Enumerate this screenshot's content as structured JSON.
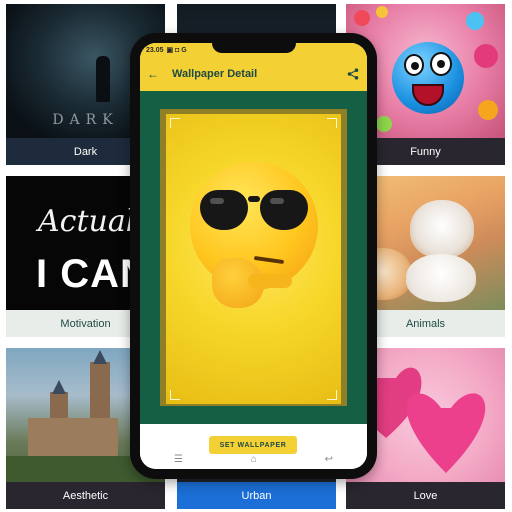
{
  "categories": [
    {
      "id": "dark",
      "label": "Dark",
      "art_text": "DARK"
    },
    {
      "id": "urban-top",
      "label": ""
    },
    {
      "id": "funny",
      "label": "Funny"
    },
    {
      "id": "motivation",
      "label": "Motivation",
      "art_line1": "Actually",
      "art_line2": "I CAN"
    },
    {
      "id": "animals",
      "label": "Animals"
    },
    {
      "id": "aesthetic",
      "label": "Aesthetic"
    },
    {
      "id": "urban",
      "label": "Urban"
    },
    {
      "id": "love",
      "label": "Love"
    }
  ],
  "phone": {
    "status_time": "23.05",
    "status_icons": "▣ ◘ G",
    "title": "Wallpaper Detail",
    "back_icon": "arrow-left-icon",
    "share_icon": "share-icon",
    "set_wallpaper_label": "SET WALLPAPER",
    "nav": {
      "menu": "☰",
      "home": "⌂",
      "back": "↩"
    }
  },
  "colors": {
    "accent": "#f3d033",
    "title_text": "#1f4a45",
    "preview_frame": "#155f45",
    "label_dark": "#1e2b3c",
    "label_blue": "#1b6fd6"
  }
}
